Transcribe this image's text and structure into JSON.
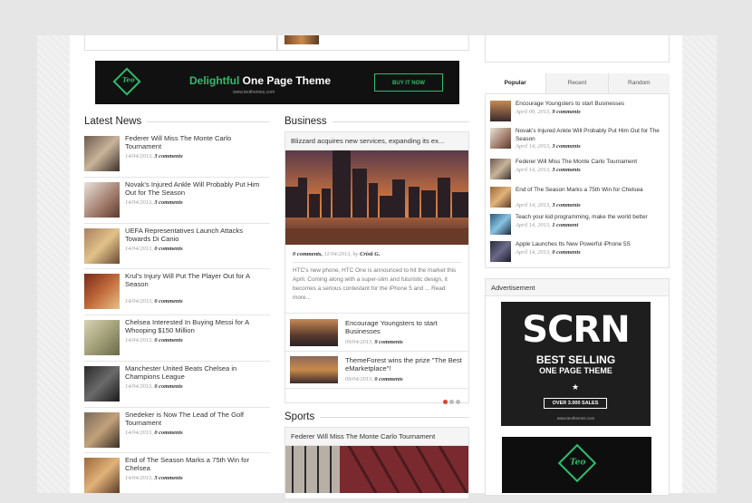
{
  "banner": {
    "headline_accent": "Delightful",
    "headline_rest": " One Page Theme",
    "site": "www.teothemes.com",
    "cta": "BUY IT NOW",
    "logo_text": "Teo"
  },
  "latest_news": {
    "heading": "Latest News",
    "items": [
      {
        "title": "Federer Will Miss The Monte Carlo Tournament",
        "date": "14/04/2013,",
        "comments": "3 comments"
      },
      {
        "title": "Novak's Injured Ankle Will Probably Put Him Out for The Season",
        "date": "14/04/2013,",
        "comments": "3 comments"
      },
      {
        "title": "UEFA Representatives Launch Attacks Towards Di Canio",
        "date": "14/04/2013,",
        "comments": "0 comments"
      },
      {
        "title": "Krul's Injury Will Put The Player Out for A Season",
        "date": "14/04/2013,",
        "comments": "0 comments"
      },
      {
        "title": "Chelsea Interested In Buying Messi for A Whooping $150 Million",
        "date": "14/04/2013,",
        "comments": "0 comments"
      },
      {
        "title": "Manchester United Beats Chelsea in Champions League",
        "date": "14/04/2013,",
        "comments": "0 comments"
      },
      {
        "title": "Snedeker is Now The Lead of The Golf Tournament",
        "date": "14/04/2013,",
        "comments": "0 comments"
      },
      {
        "title": "End of The Season Marks a 75th Win for Chelsea",
        "date": "14/04/2013,",
        "comments": "3 comments"
      }
    ]
  },
  "business": {
    "heading": "Business",
    "featured_title": "Blizzard acquires new services, expanding its ex...",
    "featured_comments": "0 comments,",
    "featured_date": "11/04/2013, by",
    "featured_author": "Cristi G.",
    "excerpt": "HTC's new phone, HTC One is announced to hit the market this April. Coming along with a super-slim and futuristic design, it becomes a serious contestant for the iPhone 5 and ... Read more...",
    "items": [
      {
        "title": "Encourage Youngsters to start Businesses",
        "date": "09/04/2013,",
        "comments": "9 comments"
      },
      {
        "title": "ThemeForest wins the prize \"The Best eMarketplace\"!",
        "date": "09/04/2013,",
        "comments": "0 comments"
      }
    ]
  },
  "sports": {
    "heading": "Sports",
    "featured_title": "Federer Will Miss The Monte Carlo Tournament"
  },
  "popular": {
    "tabs": [
      "Popular",
      "Recent",
      "Random"
    ],
    "items": [
      {
        "title": "Encourage Youngsters to start Businesses",
        "date": "April 09, 2013,",
        "comments": "9 comments"
      },
      {
        "title": "Novak's Injured Ankle Will Probably Put Him Out for The Season",
        "date": "April 14, 2013,",
        "comments": "3 comments"
      },
      {
        "title": "Federer Will Miss The Monte Carlo Tournament",
        "date": "April 14, 2013,",
        "comments": "3 comments"
      },
      {
        "title": "End of The Season Marks a 75th Win for Chelsea",
        "date": "April 14, 2013,",
        "comments": "3 comments"
      },
      {
        "title": "Teach your kid programming, make the world better",
        "date": "April 14, 2013,",
        "comments": "1 comment"
      },
      {
        "title": "Apple Launches Its New Powerful iPhone 5S",
        "date": "April 14, 2013,",
        "comments": "0 comments"
      }
    ]
  },
  "advertisement": {
    "heading": "Advertisement",
    "scrn": "SCRN",
    "line1": "BEST SELLING",
    "line2": "ONE PAGE THEME",
    "sales": "OVER 3.000 SALES",
    "site": "www.teothemes.com",
    "logo_text": "Teo"
  },
  "colors": {
    "accent_green": "#2dbd6e",
    "slider_active": "#e0412f"
  }
}
